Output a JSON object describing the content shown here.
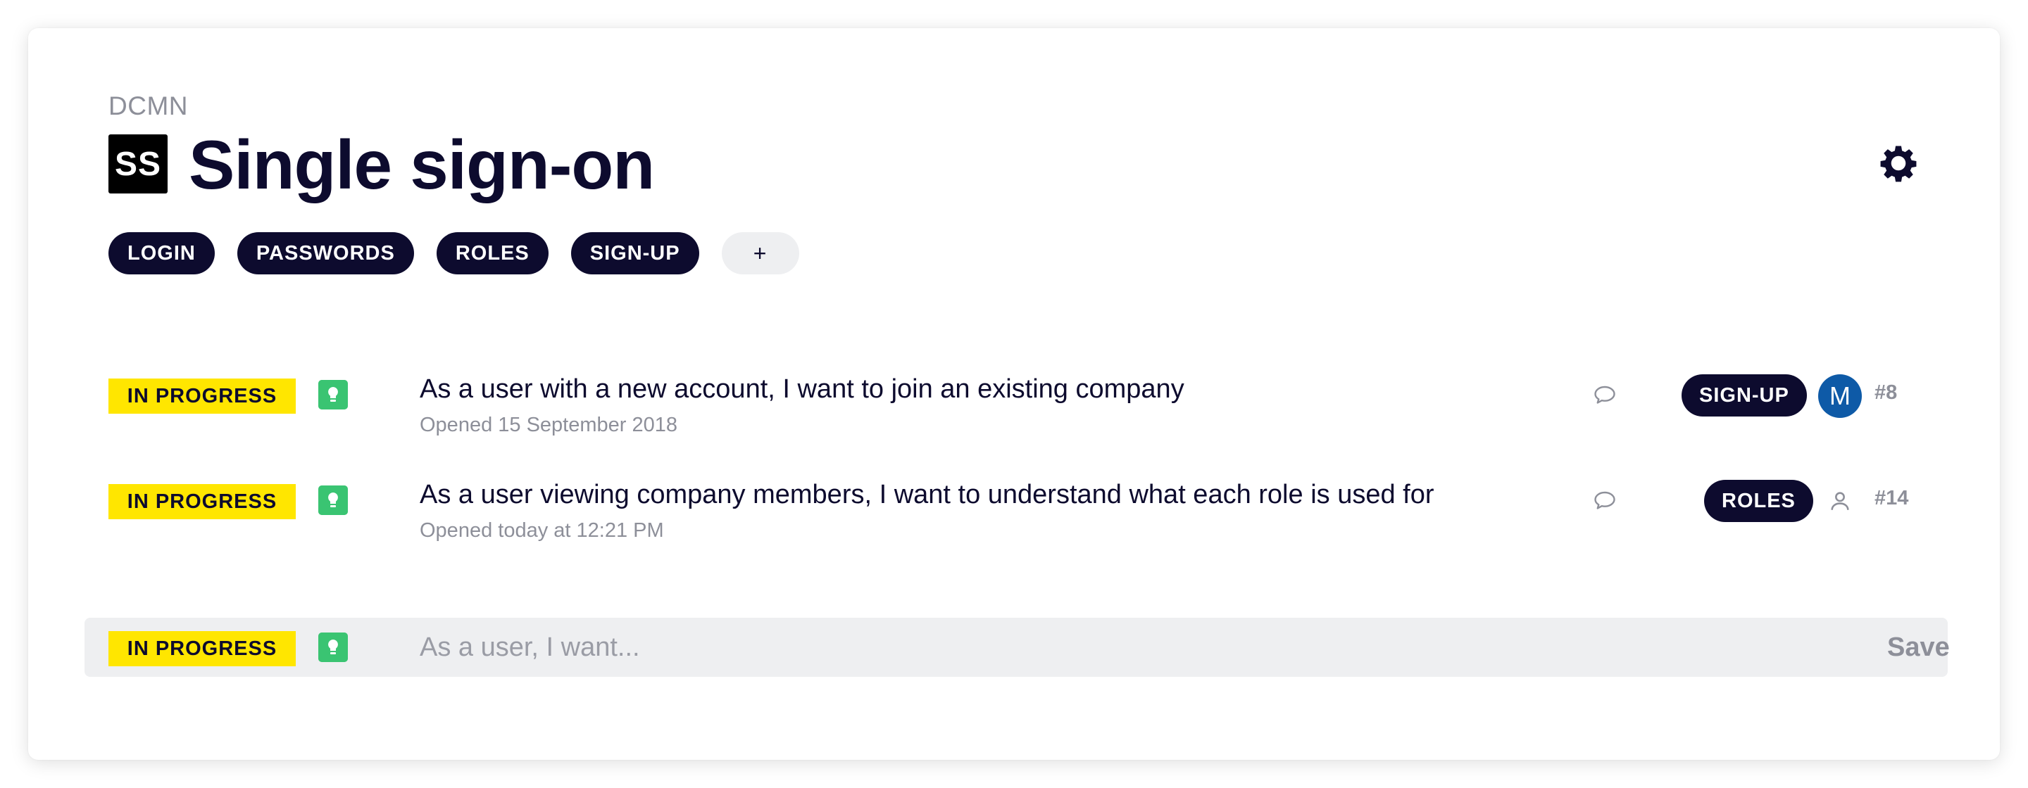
{
  "header": {
    "org": "DCMN",
    "project_icon": "SS",
    "title": "Single sign-on"
  },
  "tags": [
    "LOGIN",
    "PASSWORDS",
    "ROLES",
    "SIGN-UP"
  ],
  "add_tag_label": "+",
  "stories": [
    {
      "status": "IN PROGRESS",
      "title": "As a user with a new account, I want to join an existing company",
      "meta": "Opened 15 September 2018",
      "tag": "SIGN-UP",
      "assignee_initial": "M",
      "number": "#8"
    },
    {
      "status": "IN PROGRESS",
      "title": "As a user viewing company members, I want to understand what each role is used for",
      "meta": "Opened today at 12:21 PM",
      "tag": "ROLES",
      "assignee_initial": "",
      "number": "#14"
    }
  ],
  "new_story": {
    "status": "IN PROGRESS",
    "placeholder": "As a user, I want...",
    "save_label": "Save"
  },
  "icons": {
    "settings": "gear-icon",
    "story_type": "lightbulb-icon",
    "comments": "speech-bubble-icon",
    "unassigned": "user-icon"
  },
  "colors": {
    "accent_dark": "#0d0b2e",
    "status_in_progress": "#ffe600",
    "story_type_green": "#3ac472",
    "avatar_blue": "#0e5aa7"
  }
}
